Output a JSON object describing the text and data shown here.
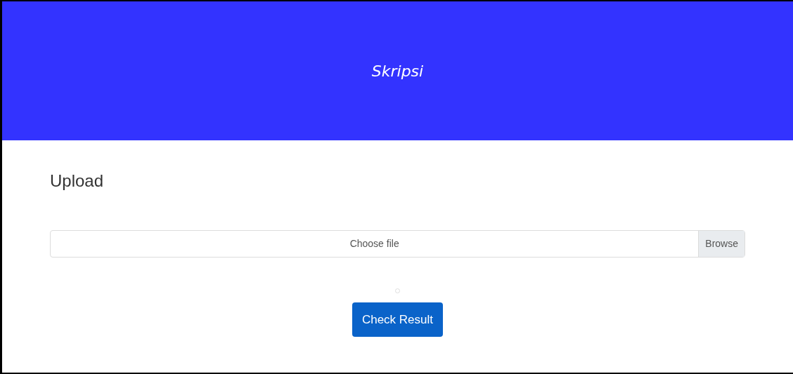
{
  "header": {
    "title": "Skripsi"
  },
  "section": {
    "heading": "Upload"
  },
  "file_input": {
    "placeholder": "Choose file",
    "button": "Browse"
  },
  "submit_button": "Check Result"
}
